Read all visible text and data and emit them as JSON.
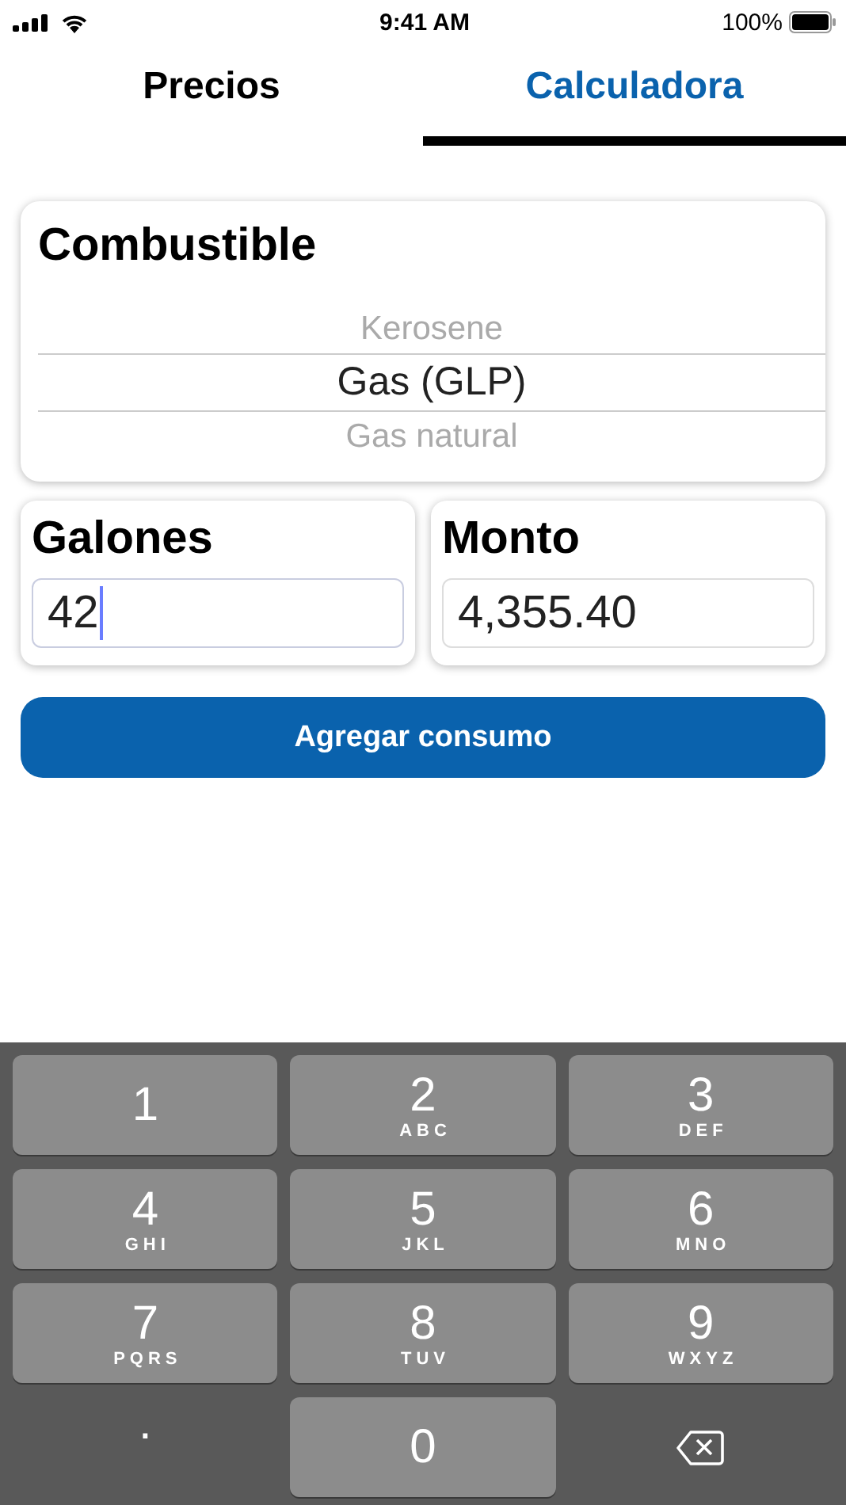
{
  "status_bar": {
    "time": "9:41 AM",
    "battery": "100%"
  },
  "tabs": [
    {
      "label": "Precios",
      "selected": false
    },
    {
      "label": "Calculadora",
      "selected": true
    }
  ],
  "fuel_picker": {
    "title": "Combustible",
    "options": [
      {
        "label": "Kerosene",
        "selected": false
      },
      {
        "label": "Gas (GLP)",
        "selected": true
      },
      {
        "label": "Gas natural",
        "selected": false
      }
    ]
  },
  "fields": [
    {
      "label": "Galones",
      "value": "42",
      "focused": true
    },
    {
      "label": "Monto",
      "value": "4,355.40",
      "focused": false
    }
  ],
  "add_button": "Agregar consumo",
  "keypad": [
    {
      "kind": "digit",
      "digit": "1"
    },
    {
      "kind": "digit",
      "digit": "2",
      "letters": "ABC"
    },
    {
      "kind": "digit",
      "digit": "3",
      "letters": "DEF"
    },
    {
      "kind": "digit",
      "digit": "4",
      "letters": "GHI"
    },
    {
      "kind": "digit",
      "digit": "5",
      "letters": "JKL"
    },
    {
      "kind": "digit",
      "digit": "6",
      "letters": "MNO"
    },
    {
      "kind": "digit",
      "digit": "7",
      "letters": "PQRS"
    },
    {
      "kind": "digit",
      "digit": "8",
      "letters": "TUV"
    },
    {
      "kind": "digit",
      "digit": "9",
      "letters": "WXYZ"
    },
    {
      "kind": "dot",
      "digit": "."
    },
    {
      "kind": "digit",
      "digit": "0"
    },
    {
      "kind": "delete"
    }
  ]
}
